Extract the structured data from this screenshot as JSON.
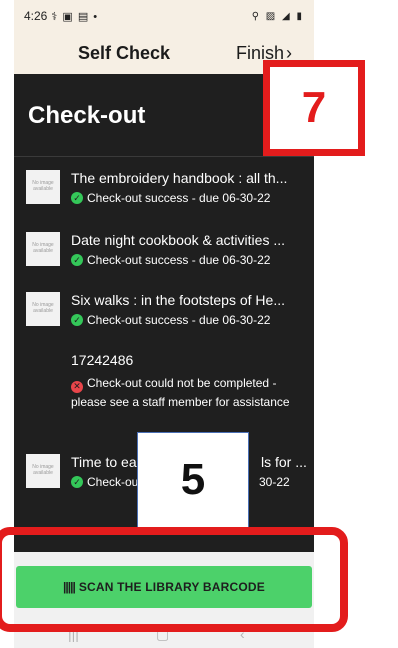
{
  "status_bar": {
    "time": "4:26",
    "left_icons": "⚕ ▣ ▤ •",
    "right_icons": "⚲ ▨ ◢ ▮"
  },
  "header": {
    "title": "Self Check",
    "finish_label": "Finish",
    "finish_icon": "chevron-right-icon"
  },
  "section": {
    "title": "Check-out"
  },
  "thumb_placeholder": "No image available",
  "items": [
    {
      "title": "The embroidery handbook : all th...",
      "status": "Check-out success - due 06-30-22"
    },
    {
      "title": "Date night cookbook & activities ...",
      "status": "Check-out success - due 06-30-22"
    },
    {
      "title": "Six walks : in the footsteps of He...",
      "status": "Check-out success - due 06-30-22"
    },
    {
      "title": "Time to ea",
      "title_end": "ls for ...",
      "status": "Check-ou",
      "status_end": "30-22"
    }
  ],
  "failed_item": {
    "barcode": "17242486",
    "message": "Check-out could not be completed - please see a staff member for assistance"
  },
  "scan_button": {
    "icon": "barcode-icon",
    "label": "SCAN THE LIBRARY BARCODE"
  },
  "annotations": {
    "box_top": "7",
    "box_middle": "5"
  },
  "colors": {
    "success": "#34c759",
    "error": "#e8454a",
    "scan_button": "#4cd16a",
    "annotation": "#e31c1c",
    "header_bg": "#f6efe4",
    "content_bg": "#1f1f1f"
  }
}
